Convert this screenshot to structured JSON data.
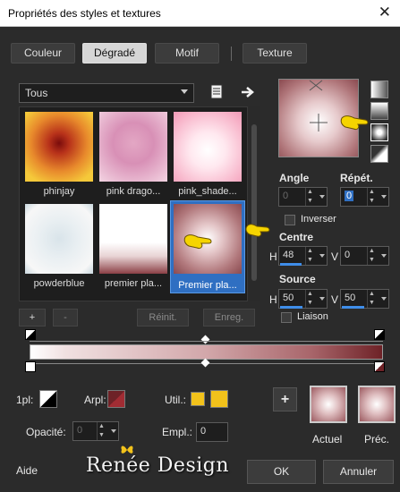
{
  "window": {
    "title": "Propriétés des styles et textures",
    "close_glyph": "✕"
  },
  "tabs": [
    {
      "label": "Couleur",
      "active": false
    },
    {
      "label": "Dégradé",
      "active": true
    },
    {
      "label": "Motif",
      "active": false
    },
    {
      "label": "Texture",
      "active": false
    }
  ],
  "category_select": {
    "value": "Tous"
  },
  "toolbar_icons": [
    "document-menu-icon",
    "arrow-right-icon"
  ],
  "gradients": [
    {
      "label": "phinjay",
      "selected": false
    },
    {
      "label": "pink drago...",
      "selected": false
    },
    {
      "label": "pink_shade...",
      "selected": false
    },
    {
      "label": "powderblue",
      "selected": false
    },
    {
      "label": "premier pla...",
      "selected": false
    },
    {
      "label": "Premier pla...",
      "selected": true
    }
  ],
  "list_buttons": {
    "add": "+",
    "remove": "-",
    "reset": "Réinit.",
    "save": "Enreg."
  },
  "settings": {
    "angle_label": "Angle",
    "angle_value": "0",
    "repeat_label": "Répét.",
    "repeat_value": "0",
    "invert_label": "Inverser",
    "invert_checked": false,
    "center_label": "Centre",
    "center_h_label": "H",
    "center_h": "48",
    "center_v_label": "V",
    "center_v": "0",
    "source_label": "Source",
    "source_h_label": "H",
    "source_h": "50",
    "source_v_label": "V",
    "source_v": "50",
    "link_label": "Liaison",
    "link_checked": false
  },
  "bottom": {
    "opacity_short_label": "1pl:",
    "arpl_label": "Arpl:",
    "util_label": "Util.:",
    "opacity_label": "Opacité:",
    "opacity_value": "0",
    "position_label": "Empl.:",
    "position_value": "0",
    "current_label": "Actuel",
    "previous_label": "Préc.",
    "add_button": "+"
  },
  "footer": {
    "help": "Aide",
    "logo": "Renée Design",
    "ok": "OK",
    "cancel": "Annuler"
  },
  "colors": {
    "accent": "#3f8de8",
    "gold": "#f2c21b",
    "selection": "#2f6fc2"
  }
}
